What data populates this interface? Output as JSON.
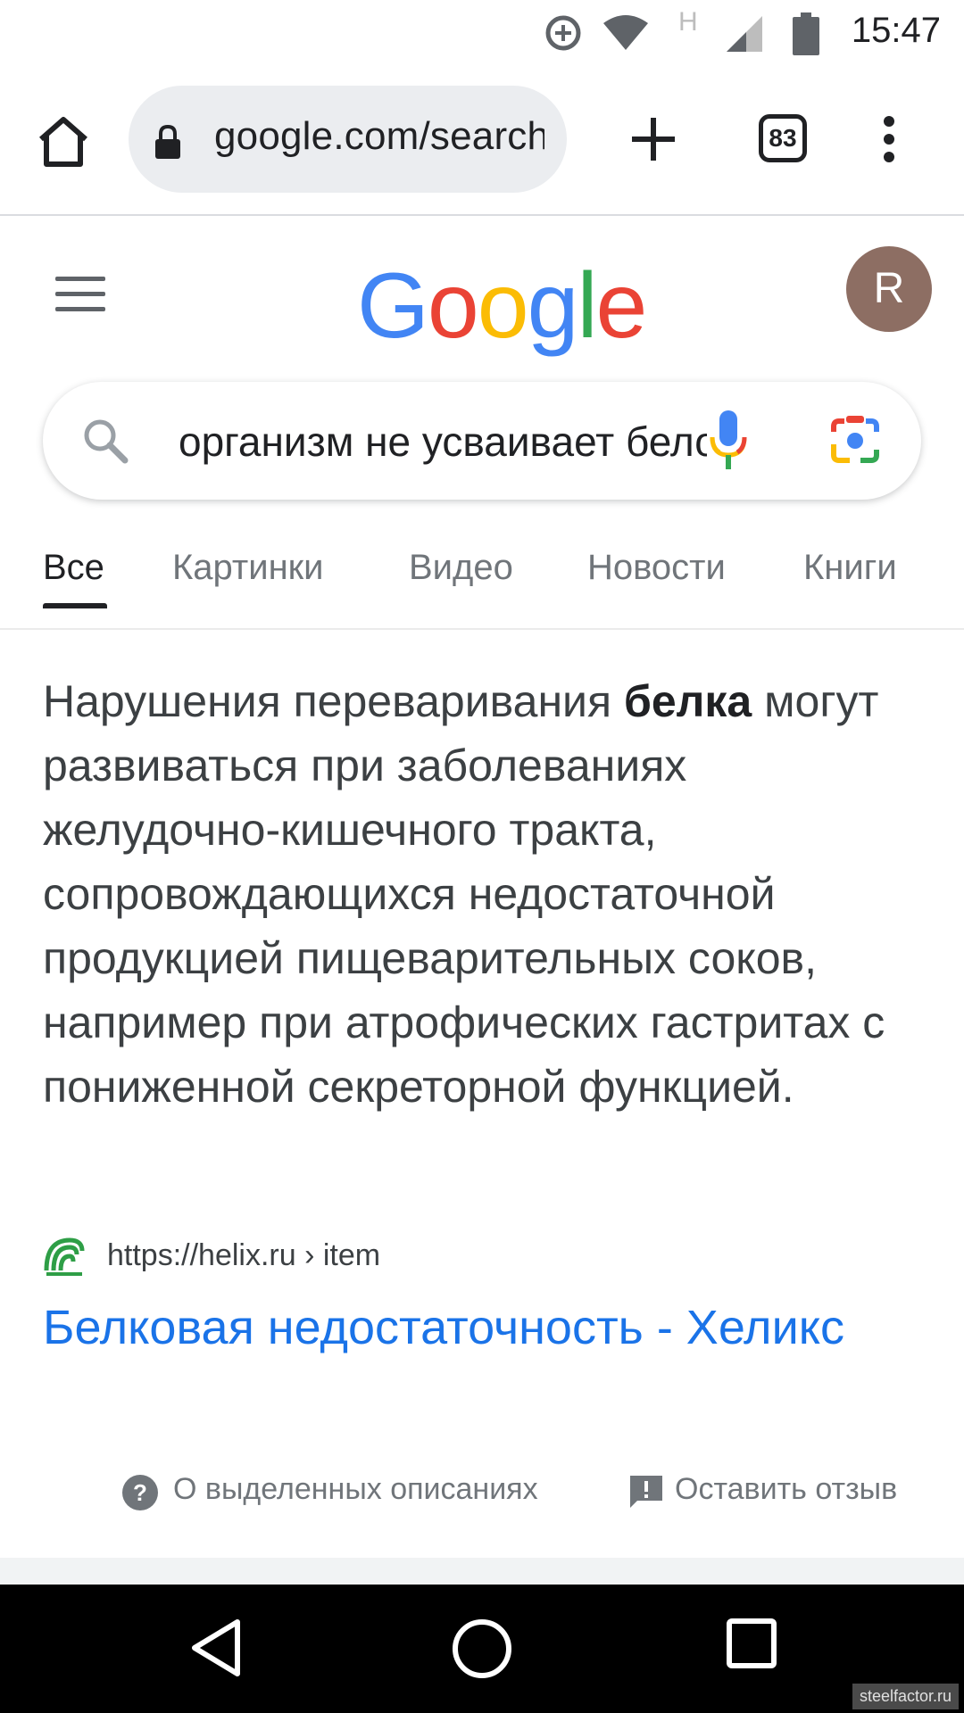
{
  "status_bar": {
    "time": "15:47",
    "network_badge": "H"
  },
  "browser": {
    "url": "google.com/search",
    "tab_count": "83"
  },
  "google": {
    "logo_letters": [
      "G",
      "o",
      "o",
      "g",
      "l",
      "e"
    ],
    "logo_colors": [
      "#4285F4",
      "#EA4335",
      "#FBBC05",
      "#4285F4",
      "#34A853",
      "#EA4335"
    ],
    "avatar_letter": "R",
    "avatar_color": "#8d6e63"
  },
  "search": {
    "query": "организм не усваивает белок"
  },
  "tabs": [
    {
      "label": "Все",
      "active": true
    },
    {
      "label": "Картинки",
      "active": false
    },
    {
      "label": "Видео",
      "active": false
    },
    {
      "label": "Новости",
      "active": false
    },
    {
      "label": "Книги",
      "active": false
    }
  ],
  "snippet": {
    "text_before": "Нарушения переваривания ",
    "bold": "белка",
    "text_after": " могут развиваться при заболеваниях желудочно-кишечного тракта, сопровождающихся недостаточной продукцией пищеварительных соков, например при атрофических гастритах с пониженной секреторной функцией."
  },
  "result": {
    "source_url": "https://helix.ru › item",
    "title": "Белковая недостаточность - Хеликс"
  },
  "footer_links": {
    "about": "О выделенных описаниях",
    "feedback": "Оставить отзыв"
  },
  "watermark": "steelfactor.ru",
  "colors": {
    "link": "#1a73e8",
    "text": "#202124",
    "secondary": "#70757a"
  }
}
